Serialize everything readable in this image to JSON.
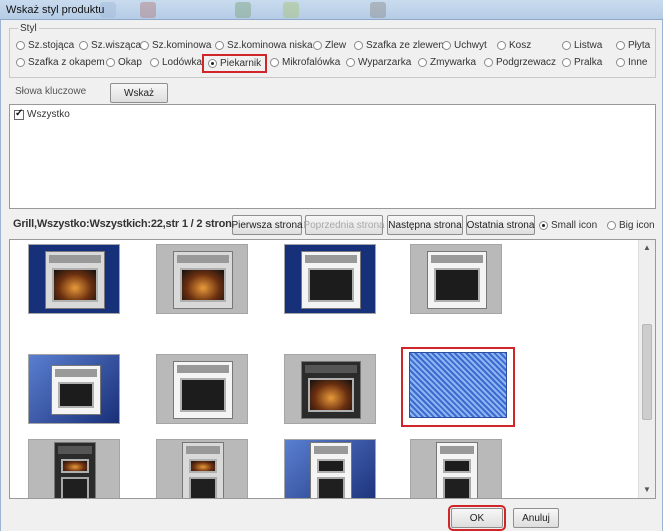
{
  "window": {
    "title": "Wskaż styl produktu"
  },
  "styl": {
    "legend": "Styl",
    "row1": [
      "Sz.stojąca",
      "Sz.wisząca",
      "Sz.kominowa",
      "Sz.kominowa niska",
      "Zlew",
      "Szafka ze zlewem",
      "Uchwyt",
      "Kosz",
      "Listwa",
      "Płyta"
    ],
    "row2": [
      "Szafka z okapem",
      "Okap",
      "Lodówka",
      "Piekarnik",
      "Mikrofalówka",
      "Wyparzarka",
      "Zmywarka",
      "Podgrzewacz",
      "Pralka",
      "Inne"
    ],
    "selected": "Piekarnik"
  },
  "keywords": {
    "label": "Słowa kluczowe",
    "button": "Wskaż",
    "items": [
      {
        "label": "Wszystko",
        "checked": true
      }
    ]
  },
  "navigation": {
    "info": "Grill,Wszystko:Wszystkich:22,str 1 / 2 stron",
    "first": "Pierwsza strona",
    "prev": "Poprzednia strona",
    "next": "Następna strona",
    "last": "Ostatnia strona",
    "small_icon": "Small icon",
    "big_icon": "Big icon",
    "icon_size_selected": "Small icon"
  },
  "grid": {
    "thumbnails": [
      {
        "name": "oven-1",
        "style": "blue-bg-steel-glow"
      },
      {
        "name": "oven-2",
        "style": "gray-bg-steel-glow"
      },
      {
        "name": "oven-3",
        "style": "blue-bg-white"
      },
      {
        "name": "oven-4",
        "style": "gray-bg-white"
      },
      {
        "name": "oven-5",
        "style": "blue-bg-white-freestanding"
      },
      {
        "name": "oven-6",
        "style": "gray-bg-white"
      },
      {
        "name": "oven-7",
        "style": "gray-bg-black"
      },
      {
        "name": "oven-8",
        "style": "selected-blue-mesh",
        "selected": true
      },
      {
        "name": "oven-9",
        "style": "gray-bg-black-double"
      },
      {
        "name": "oven-10",
        "style": "gray-bg-steel-double"
      },
      {
        "name": "oven-11",
        "style": "blue-bg-white-freestanding"
      },
      {
        "name": "oven-12",
        "style": "gray-bg-white-tall"
      }
    ]
  },
  "footer": {
    "ok": "OK",
    "cancel": "Anuluj"
  },
  "colors": {
    "highlight": "#d0262a",
    "titlebar": "#c9dbee",
    "thumb_blue": "#16307a",
    "thumb_gray": "#b9b9b9"
  },
  "icons": {
    "up": "scroll-up-icon",
    "down": "scroll-down-icon"
  }
}
